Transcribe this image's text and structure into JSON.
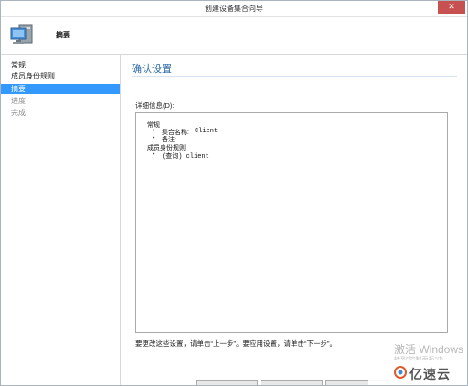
{
  "window": {
    "title": "创建设备集合向导"
  },
  "header": {
    "heading": "摘要"
  },
  "sidebar": {
    "items": [
      {
        "label": "常规",
        "state": "normal"
      },
      {
        "label": "成员身份规则",
        "state": "normal"
      },
      {
        "label": "摘要",
        "state": "active"
      },
      {
        "label": "进度",
        "state": "disabled"
      },
      {
        "label": "完成",
        "state": "disabled"
      }
    ]
  },
  "main": {
    "title": "确认设置",
    "details_label": "详细信息(D):",
    "details": {
      "general_heading": "常规",
      "collection_name_label": "集合名称:",
      "collection_name_value": "Client",
      "comment_label": "备注:",
      "membership_heading": "成员身份规则",
      "rule_text": "(查询) client"
    },
    "footer_text": "要更改这些设置，请单击“上一步”。要应用设置，请单击“下一步”。"
  },
  "overlay": {
    "watermark_line1": "激活 Windows",
    "watermark_line2": "转到\"控制面板\"中",
    "brand_text": "亿速云"
  },
  "colors": {
    "accent": "#3399ff",
    "title_blue": "#2b6aa6",
    "close_red": "#c75050"
  }
}
